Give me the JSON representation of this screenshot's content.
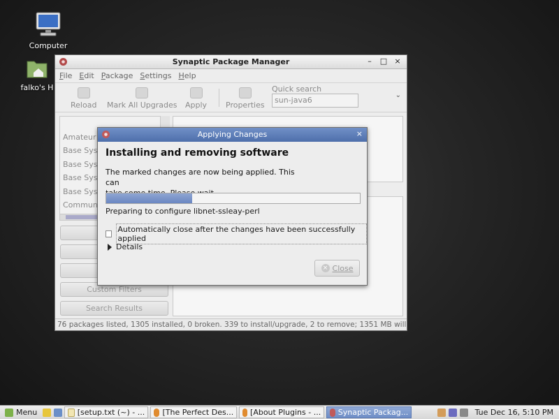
{
  "desktop": {
    "icons": [
      {
        "label": "Computer"
      },
      {
        "label": "falko's H"
      }
    ]
  },
  "window": {
    "title": "Synaptic Package Manager",
    "controls": [
      "–",
      "□",
      "×"
    ],
    "menu": [
      "File",
      "Edit",
      "Package",
      "Settings",
      "Help"
    ],
    "toolbar": {
      "reload": "Reload",
      "mark_all": "Mark All Upgrades",
      "apply": "Apply",
      "properties": "Properties",
      "quick_search_label": "Quick search",
      "quick_search_value": "sun-java6"
    },
    "sections": [
      "",
      "Amateur R",
      "Base Syst",
      "Base Syst",
      "Base Syst",
      "Base Syst",
      "Communi"
    ],
    "filter_buttons": [
      "",
      "",
      "",
      "Custom Filters",
      "Search Results"
    ],
    "status": "76 packages listed, 1305 installed, 0 broken. 339 to install/upgrade, 2 to remove; 1351 MB will be us"
  },
  "dialog": {
    "title": "Applying Changes",
    "heading": "Installing and removing software",
    "message_line1": "The marked changes are now being applied. This can",
    "message_line2": "take some time. Please wait.",
    "progress": 0.34,
    "progress_status": "Preparing to configure libnet-ssleay-perl",
    "auto_close_label": "Automatically close after the changes have been successfully applied",
    "auto_close_checked": false,
    "details_label": "Details",
    "close_label": "Close"
  },
  "taskbar": {
    "menu_label": "Menu",
    "tasks": [
      {
        "label": "[setup.txt (~) - ...",
        "active": false
      },
      {
        "label": "[The Perfect Des...",
        "active": false
      },
      {
        "label": "[About Plugins - ...",
        "active": false
      },
      {
        "label": "Synaptic Packag...",
        "active": true
      }
    ],
    "clock": "Tue Dec 16,  5:10 PM"
  }
}
